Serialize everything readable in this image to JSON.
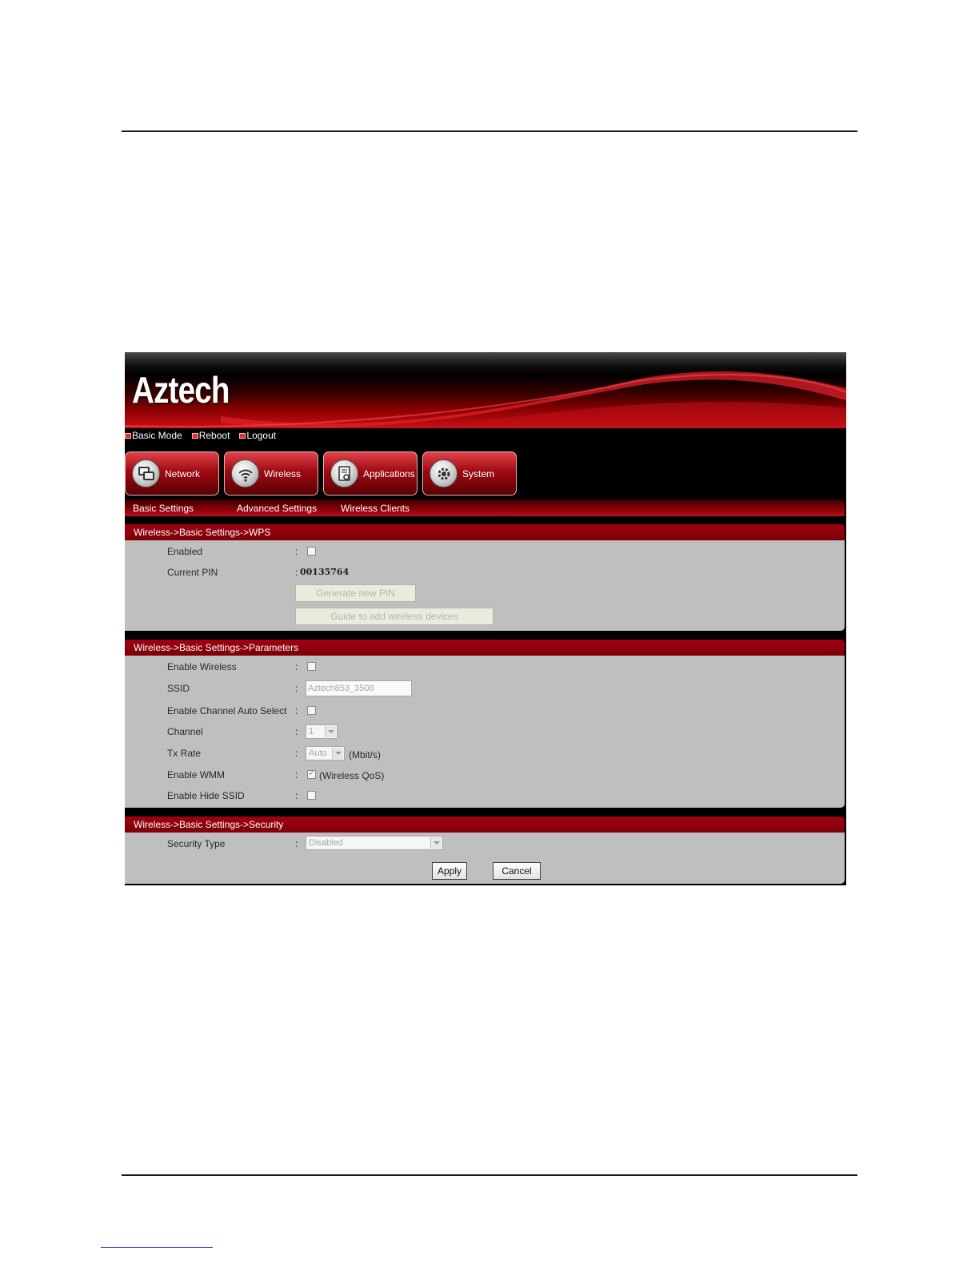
{
  "brand": {
    "logo_text": "Aztech"
  },
  "top_links": [
    {
      "label": "Basic Mode"
    },
    {
      "label": "Reboot"
    },
    {
      "label": "Logout"
    }
  ],
  "nav_tabs": [
    {
      "label": "Network",
      "icon": "network-icon"
    },
    {
      "label": "Wireless",
      "icon": "wifi-icon"
    },
    {
      "label": "Applications",
      "icon": "applications-icon"
    },
    {
      "label": "System",
      "icon": "gear-icon"
    }
  ],
  "sub_nav": [
    {
      "label": "Basic Settings"
    },
    {
      "label": "Advanced Settings"
    },
    {
      "label": "Wireless Clients"
    }
  ],
  "wps": {
    "title": "Wireless->Basic Settings->WPS",
    "enabled_label": "Enabled",
    "enabled_checked": false,
    "pin_label": "Current PIN",
    "pin_value": "00135764",
    "generate_button": "Generate new PIN",
    "guide_button": "Guide to add wireless devices"
  },
  "params": {
    "title": "Wireless->Basic Settings->Parameters",
    "enable_wireless_label": "Enable Wireless",
    "enable_wireless_checked": false,
    "ssid_label": "SSID",
    "ssid_value": "Aztech853_3508",
    "auto_channel_label": "Enable Channel Auto Select",
    "auto_channel_checked": false,
    "channel_label": "Channel",
    "channel_value": "1",
    "txrate_label": "Tx Rate",
    "txrate_value": "Auto",
    "txrate_unit": "(Mbit/s)",
    "wmm_label": "Enable WMM",
    "wmm_checked": true,
    "wmm_note": "(Wireless QoS)",
    "hide_ssid_label": "Enable Hide SSID",
    "hide_ssid_checked": false
  },
  "security": {
    "title": "Wireless->Basic Settings->Security",
    "type_label": "Security Type",
    "type_value": "Disabled"
  },
  "actions": {
    "apply": "Apply",
    "cancel": "Cancel"
  },
  "colon": ":"
}
